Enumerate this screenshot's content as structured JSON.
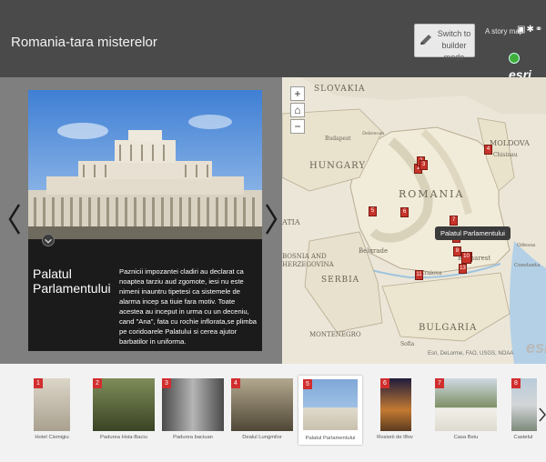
{
  "header": {
    "title": "Romania-tara misterelor",
    "builder_button_label": "Switch to builder mode",
    "story_map_label": "A story map",
    "share_icons": [
      "facebook-icon",
      "twitter-icon",
      "link-icon"
    ],
    "brand": "esri"
  },
  "panel": {
    "title": "Palatul Parlamentului",
    "description": "Paznicii impozantei cladiri au declarat ca noaptea tarziu aud zgomote, iesi nu este nimeni inauntru tipetesi ca sistemele de alarma incep sa tiuie fara motiv. Toate acestea au inceput in urma cu un deceniu, cand \"Ana\", fata cu rochie inflorata,se plimba pe coridoarele Palatului si cerea ajutor barbatilor in uniforma."
  },
  "map": {
    "labels": {
      "slovakia": "SLOVAKIA",
      "budapest": "Budapest",
      "debrecen": "Debrecen",
      "hungary": "HUNGARY",
      "moldova": "MOLDOVA",
      "chisinau": "Chisinau",
      "romania": "ROMANIA",
      "croatia": "ATIA",
      "bosnia": "BOSNIA AND HERZEGOVINA",
      "belgrade": "Belgrade",
      "serbia": "SERBIA",
      "craiova": "Craiova",
      "bucharest": "Bucharest",
      "montenegro": "MONTENEGRO",
      "bulgaria": "BULGARIA",
      "sofia": "Sofia",
      "constanta": "Constanta",
      "odessa": "Odessa"
    },
    "tooltip": "Palatul Parlamentului",
    "attribution": "Esri, DeLorme, FAO, USGS, NOAA",
    "logo": "esri",
    "controls": [
      "+",
      "⌂",
      "−"
    ],
    "marker_numbers": [
      "1",
      "2",
      "3",
      "4",
      "5",
      "6",
      "7",
      "8",
      "9",
      "10",
      "11",
      "12",
      "13"
    ]
  },
  "carousel": {
    "items": [
      {
        "number": "1",
        "caption": "Hotel Cismigiu",
        "color": "#c9c4b8"
      },
      {
        "number": "2",
        "caption": "Padurea Hoia-Baciu",
        "color": "#5c6a3c"
      },
      {
        "number": "3",
        "caption": "Padurea baciuan",
        "color": "#8b8b8b"
      },
      {
        "number": "4",
        "caption": "Dealul Lungmilor",
        "color": "#7a6c55"
      },
      {
        "number": "5",
        "caption": "Palatul Parlamentului",
        "color": "#9ab6d8"
      },
      {
        "number": "6",
        "caption": "Rosiorii de Ilfov",
        "color": "#2d2a4a"
      },
      {
        "number": "7",
        "caption": "Casa Beiu",
        "color": "#8c9b7a"
      },
      {
        "number": "8",
        "caption": "Castelul",
        "color": "#a4b8c8"
      }
    ]
  },
  "colors": {
    "header_bg": "#4a4a4a",
    "main_bg": "#7f7f7f",
    "marker": "#c8342a",
    "badge": "#d12e2e"
  }
}
